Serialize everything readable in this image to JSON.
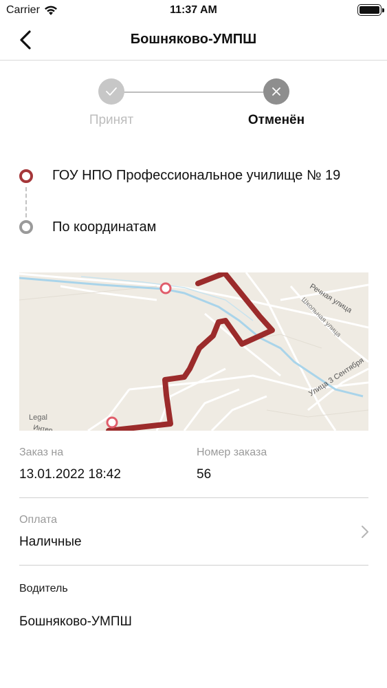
{
  "status_bar": {
    "carrier": "Carrier",
    "time": "11:37 AM",
    "icons": [
      "wifi-icon",
      "battery-icon"
    ]
  },
  "nav": {
    "title": "Бошняково-УМПШ",
    "back_icon": "chevron-left-icon"
  },
  "stepper": {
    "steps": [
      {
        "label": "Принят",
        "icon": "check-icon",
        "state": "done"
      },
      {
        "label": "Отменён",
        "icon": "close-icon",
        "state": "current"
      }
    ]
  },
  "route": {
    "from": "ГОУ НПО Профессиональное училище № 19",
    "to": "По координатам",
    "from_color": "#a5373a",
    "to_color": "#9a9a9a"
  },
  "map": {
    "route_color": "#9b2b2b",
    "streets": [
      "Речная улица",
      "Школьная улица",
      "Улица 3 Сентября",
      "Интер"
    ],
    "legal": "Legal"
  },
  "order": {
    "date_label": "Заказ на",
    "date_value": "13.01.2022 18:42",
    "number_label": "Номер заказа",
    "number_value": "56"
  },
  "payment": {
    "label": "Оплата",
    "value": "Наличные"
  },
  "driver": {
    "label": "Водитель",
    "value": "Бошняково-УМПШ"
  }
}
